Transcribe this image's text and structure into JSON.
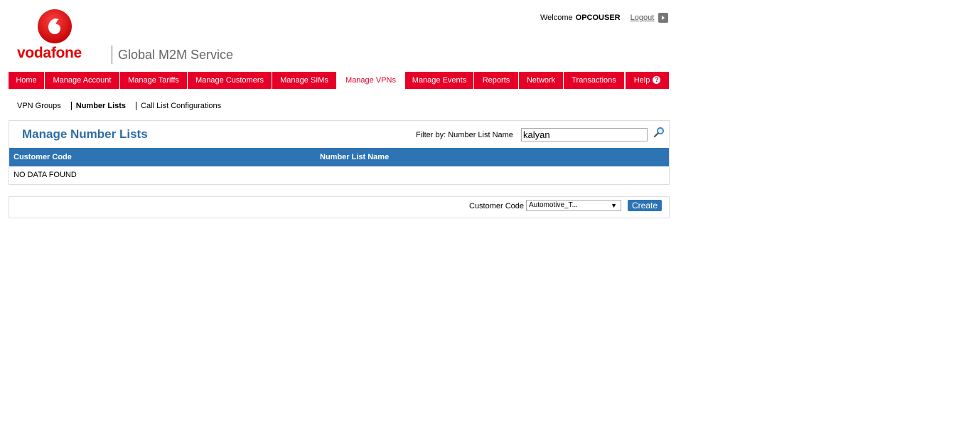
{
  "brand": {
    "wordmark": "vodafone",
    "service_name": "Global M2M Service",
    "logo_icon": "vodafone-speechmark-icon",
    "brand_color": "#e60000"
  },
  "user": {
    "welcome_text": "Welcome",
    "username": "OPCOUSER",
    "logout_label": "Logout",
    "logout_icon": "play-arrow-icon"
  },
  "nav": {
    "items": [
      {
        "label": "Home"
      },
      {
        "label": "Manage Account"
      },
      {
        "label": "Manage Tariffs"
      },
      {
        "label": "Manage Customers"
      },
      {
        "label": "Manage SIMs"
      },
      {
        "label": "Manage VPNs"
      },
      {
        "label": "Manage Events"
      },
      {
        "label": "Reports"
      },
      {
        "label": "Network"
      },
      {
        "label": "Transactions"
      },
      {
        "label": "Help"
      }
    ],
    "active": "Manage VPNs",
    "help_icon": "question-mark-icon",
    "nav_color": "#e60028"
  },
  "subnav": {
    "items": [
      {
        "label": "VPN Groups"
      },
      {
        "label": "Number Lists"
      },
      {
        "label": "Call List Configurations"
      }
    ],
    "active": "Number Lists"
  },
  "main": {
    "title": "Manage Number Lists",
    "filter_label": "Filter by: Number List Name",
    "filter_value": "kalyan",
    "search_icon": "magnifier-icon",
    "table": {
      "columns": [
        "Customer Code",
        "Number List Name"
      ],
      "empty_message": "NO DATA FOUND"
    },
    "header_color": "#2e74b5"
  },
  "create_bar": {
    "customer_code_label": "Customer Code",
    "customer_code_value": "Automotive_T...",
    "create_label": "Create"
  }
}
